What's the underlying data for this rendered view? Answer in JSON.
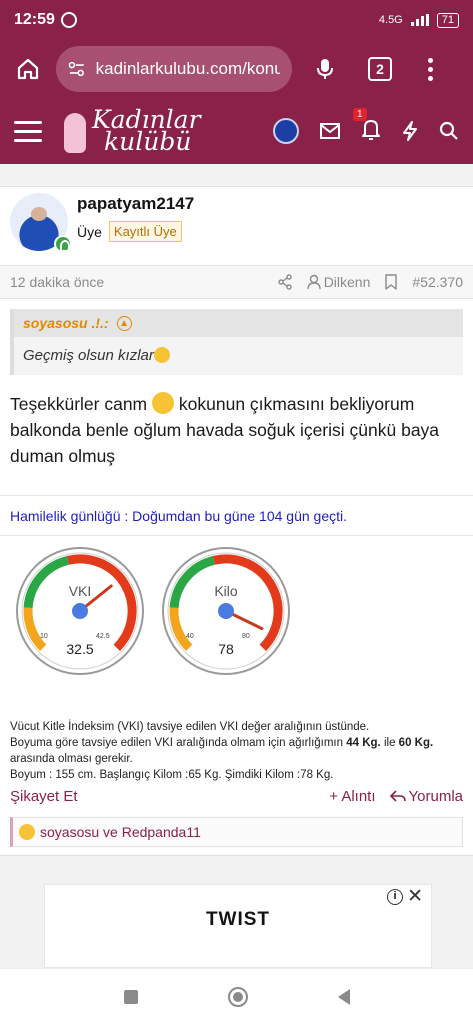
{
  "status_bar": {
    "time": "12:59",
    "network": "4.5G",
    "battery": "71"
  },
  "browser": {
    "url": "kadinlarkulubu.com/konu",
    "tab_count": "2"
  },
  "site": {
    "logo_line1": "Kadınlar",
    "logo_line2": "kulübü",
    "notification_count": "1"
  },
  "post": {
    "username": "papatyam2147",
    "role": "Üye",
    "role_tag": "Kayıtlı Üye",
    "time_ago": "12 dakika önce",
    "listen_label": "Dilkenn",
    "post_number": "#52.370",
    "quote": {
      "author": "soyasosu .!.:",
      "text": "Geçmiş olsun kızlar"
    },
    "message_part1": "Teşekkürler canm",
    "message_part2": "kokunun çıkmasını bekliyorum balkonda benle oğlum havada soğuk içerisi çünkü baya duman olmuş",
    "signature": "Hamilelik günlüğü : Doğumdan bu güne 104 gün geçti.",
    "gauges": [
      {
        "title": "VKI",
        "value": "32.5",
        "min": "10",
        "max": "42.5",
        "fraction": 0.69
      },
      {
        "title": "Kilo",
        "value": "78",
        "min": "40",
        "max": "80",
        "fraction": 0.93
      }
    ],
    "vki_line1": "Vücut Kitle İndeksim (VKI) tavsiye edilen VKI değer aralığının üstünde.",
    "vki_line2_a": "Boyuma göre tavsiye edilen VKI aralığında olmam için ağırlığımın",
    "vki_line2_b": "44 Kg.",
    "vki_line2_c": "ile",
    "vki_line2_d": "60 Kg.",
    "vki_line2_e": "arasında olması gerekir.",
    "vki_line3": "Boyum : 155 cm. Başlangıç Kilom :65 Kg. Şimdiki Kilom :78 Kg.",
    "report_label": "Şikayet Et",
    "quote_label": "+ Alıntı",
    "reply_label": "Yorumla",
    "reactions": "soyasosu ve Redpanda11"
  },
  "ad": {
    "title": "TWIST"
  },
  "colors": {
    "brand": "#8a2148",
    "accent": "#e08a00",
    "link": "#1e1ec0"
  }
}
